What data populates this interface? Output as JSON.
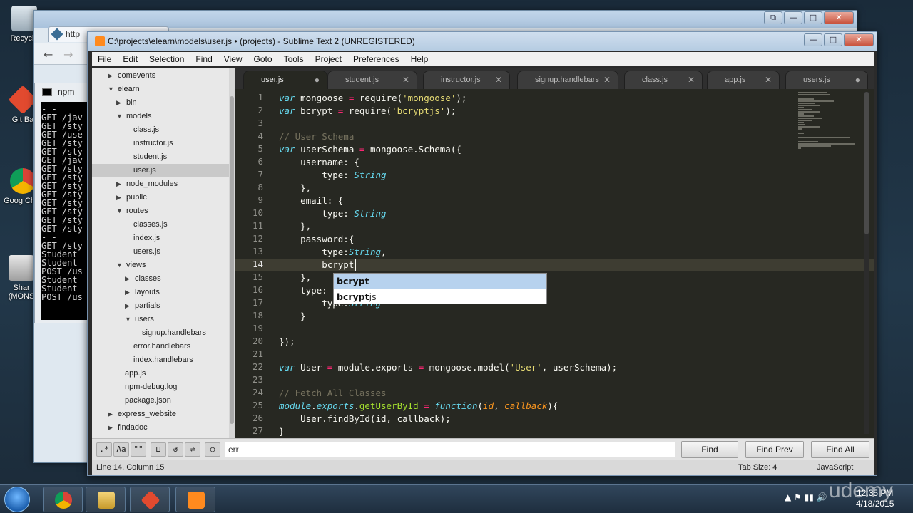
{
  "desktop": {
    "icons": [
      {
        "label": "Recycle",
        "icon": "recycle-bin-icon"
      },
      {
        "label": "Git Ba",
        "icon": "git-bash-icon"
      },
      {
        "label": "Goog Chro",
        "icon": "chrome-icon"
      },
      {
        "label": "Shar (MONS",
        "icon": "shared-folder-icon"
      }
    ]
  },
  "browser": {
    "tab_label": "http",
    "back": "←",
    "forward": "→"
  },
  "npm_window": {
    "title": "npm",
    "console_lines": [
      "- -",
      "GET /jav",
      "GET /sty",
      "GET /use",
      "GET /sty",
      "GET /sty",
      "GET /jav",
      "GET /sty",
      "GET /sty",
      "GET /sty",
      "GET /sty",
      "GET /sty",
      "GET /sty",
      "GET /sty",
      "GET /sty",
      "- -",
      "GET /sty",
      "Student",
      "Student",
      "POST /us",
      "Student",
      "Student",
      "POST /us"
    ]
  },
  "sublime": {
    "title": "C:\\projects\\elearn\\models\\user.js • (projects) - Sublime Text 2 (UNREGISTERED)",
    "window_controls": {
      "minimize": "—",
      "maximize": "□",
      "close": "✕"
    },
    "menu": [
      "File",
      "Edit",
      "Selection",
      "Find",
      "View",
      "Goto",
      "Tools",
      "Project",
      "Preferences",
      "Help"
    ],
    "sidebar": [
      {
        "label": "comevents",
        "depth": 1,
        "arrow": "▶",
        "selected": false
      },
      {
        "label": "elearn",
        "depth": 1,
        "arrow": "▼",
        "selected": false
      },
      {
        "label": "bin",
        "depth": 2,
        "arrow": "▶",
        "selected": false
      },
      {
        "label": "models",
        "depth": 2,
        "arrow": "▼",
        "selected": false
      },
      {
        "label": "class.js",
        "depth": 3,
        "arrow": "",
        "selected": false
      },
      {
        "label": "instructor.js",
        "depth": 3,
        "arrow": "",
        "selected": false
      },
      {
        "label": "student.js",
        "depth": 3,
        "arrow": "",
        "selected": false
      },
      {
        "label": "user.js",
        "depth": 3,
        "arrow": "",
        "selected": true
      },
      {
        "label": "node_modules",
        "depth": 2,
        "arrow": "▶",
        "selected": false
      },
      {
        "label": "public",
        "depth": 2,
        "arrow": "▶",
        "selected": false
      },
      {
        "label": "routes",
        "depth": 2,
        "arrow": "▼",
        "selected": false
      },
      {
        "label": "classes.js",
        "depth": 3,
        "arrow": "",
        "selected": false
      },
      {
        "label": "index.js",
        "depth": 3,
        "arrow": "",
        "selected": false
      },
      {
        "label": "users.js",
        "depth": 3,
        "arrow": "",
        "selected": false
      },
      {
        "label": "views",
        "depth": 2,
        "arrow": "▼",
        "selected": false
      },
      {
        "label": "classes",
        "depth": 3,
        "arrow": "▶",
        "selected": false
      },
      {
        "label": "layouts",
        "depth": 3,
        "arrow": "▶",
        "selected": false
      },
      {
        "label": "partials",
        "depth": 3,
        "arrow": "▶",
        "selected": false
      },
      {
        "label": "users",
        "depth": 3,
        "arrow": "▼",
        "selected": false
      },
      {
        "label": "signup.handlebars",
        "depth": 4,
        "arrow": "",
        "selected": false
      },
      {
        "label": "error.handlebars",
        "depth": 3,
        "arrow": "",
        "selected": false
      },
      {
        "label": "index.handlebars",
        "depth": 3,
        "arrow": "",
        "selected": false
      },
      {
        "label": "app.js",
        "depth": 2,
        "arrow": "",
        "selected": false
      },
      {
        "label": "npm-debug.log",
        "depth": 2,
        "arrow": "",
        "selected": false
      },
      {
        "label": "package.json",
        "depth": 2,
        "arrow": "",
        "selected": false
      },
      {
        "label": "express_website",
        "depth": 1,
        "arrow": "▶",
        "selected": false
      },
      {
        "label": "findadoc",
        "depth": 1,
        "arrow": "▶",
        "selected": false
      }
    ],
    "tabs": [
      {
        "label": "user.js",
        "close": "●",
        "active": true
      },
      {
        "label": "student.js",
        "close": "✕",
        "active": false
      },
      {
        "label": "instructor.js",
        "close": "✕",
        "active": false
      },
      {
        "label": "signup.handlebars",
        "close": "✕",
        "active": false
      },
      {
        "label": "class.js",
        "close": "✕",
        "active": false
      },
      {
        "label": "app.js",
        "close": "✕",
        "active": false
      },
      {
        "label": "users.js",
        "close": "●",
        "active": false
      }
    ],
    "current_line": 14,
    "code": [
      [
        [
          "kw",
          "var"
        ],
        [
          "t",
          " mongoose "
        ],
        [
          "op",
          "="
        ],
        [
          "t",
          " require("
        ],
        [
          "str",
          "'mongoose'"
        ],
        [
          "t",
          ");"
        ]
      ],
      [
        [
          "kw",
          "var"
        ],
        [
          "t",
          " bcrypt "
        ],
        [
          "op",
          "="
        ],
        [
          "t",
          " require("
        ],
        [
          "str",
          "'bcryptjs'"
        ],
        [
          "t",
          ");"
        ]
      ],
      [],
      [
        [
          "cm",
          "// User Schema"
        ]
      ],
      [
        [
          "kw",
          "var"
        ],
        [
          "t",
          " userSchema "
        ],
        [
          "op",
          "="
        ],
        [
          "t",
          " mongoose.Schema({"
        ]
      ],
      [
        [
          "t",
          "    username: {"
        ]
      ],
      [
        [
          "t",
          "        type: "
        ],
        [
          "ty",
          "String"
        ]
      ],
      [
        [
          "t",
          "    },"
        ]
      ],
      [
        [
          "t",
          "    email: {"
        ]
      ],
      [
        [
          "t",
          "        type: "
        ],
        [
          "ty",
          "String"
        ]
      ],
      [
        [
          "t",
          "    },"
        ]
      ],
      [
        [
          "t",
          "    password:{"
        ]
      ],
      [
        [
          "t",
          "        type:"
        ],
        [
          "ty",
          "String"
        ],
        [
          "t",
          ","
        ]
      ],
      [
        [
          "t",
          "        bcrypt"
        ]
      ],
      [
        [
          "t",
          "    },"
        ]
      ],
      [
        [
          "t",
          "    type:"
        ]
      ],
      [
        [
          "t",
          "        type:"
        ],
        [
          "ty",
          "String"
        ]
      ],
      [
        [
          "t",
          "    }"
        ]
      ],
      [],
      [
        [
          "t",
          "});"
        ]
      ],
      [],
      [
        [
          "kw",
          "var"
        ],
        [
          "t",
          " User "
        ],
        [
          "op",
          "="
        ],
        [
          "t",
          " module.exports "
        ],
        [
          "op",
          "="
        ],
        [
          "t",
          " mongoose.model("
        ],
        [
          "str",
          "'User'"
        ],
        [
          "t",
          ", userSchema);"
        ]
      ],
      [],
      [
        [
          "cm",
          "// Fetch All Classes"
        ]
      ],
      [
        [
          "kw",
          "module"
        ],
        [
          "t",
          "."
        ],
        [
          "kw",
          "exports"
        ],
        [
          "t",
          "."
        ],
        [
          "fn",
          "getUserById"
        ],
        [
          "t",
          " "
        ],
        [
          "op",
          "="
        ],
        [
          "t",
          " "
        ],
        [
          "kw",
          "function"
        ],
        [
          "t",
          "("
        ],
        [
          "par",
          "id"
        ],
        [
          "t",
          ", "
        ],
        [
          "par",
          "callback"
        ],
        [
          "t",
          "){"
        ]
      ],
      [
        [
          "t",
          "    User.findById(id, callback);"
        ]
      ],
      [
        [
          "t",
          "}"
        ]
      ]
    ],
    "autocomplete": [
      {
        "match": "bcrypt",
        "rest": "",
        "selected": true
      },
      {
        "match": "bcrypt",
        "rest": "js",
        "selected": false
      }
    ],
    "find": {
      "options": [
        ".*",
        "Aa",
        "\"\"",
        "⊔",
        "↺",
        "⇌",
        "○"
      ],
      "value": "err",
      "find_label": "Find",
      "find_prev_label": "Find Prev",
      "find_all_label": "Find All"
    },
    "status": {
      "position": "Line 14, Column 15",
      "tab_size": "Tab Size: 4",
      "syntax": "JavaScript"
    }
  },
  "taskbar": {
    "apps": [
      "chrome-icon",
      "explorer-icon",
      "git-icon",
      "sublime-icon"
    ],
    "tray": "▲  ⚑  ▮▮  🔊",
    "time": "12:35 PM",
    "date": "4/18/2015"
  },
  "watermark": "udemy",
  "colors": {
    "editor_bg": "#272822",
    "keyword": "#66d9ef",
    "string": "#e6db74",
    "comment": "#75715e",
    "operator": "#f92672",
    "function": "#a6e22e"
  }
}
